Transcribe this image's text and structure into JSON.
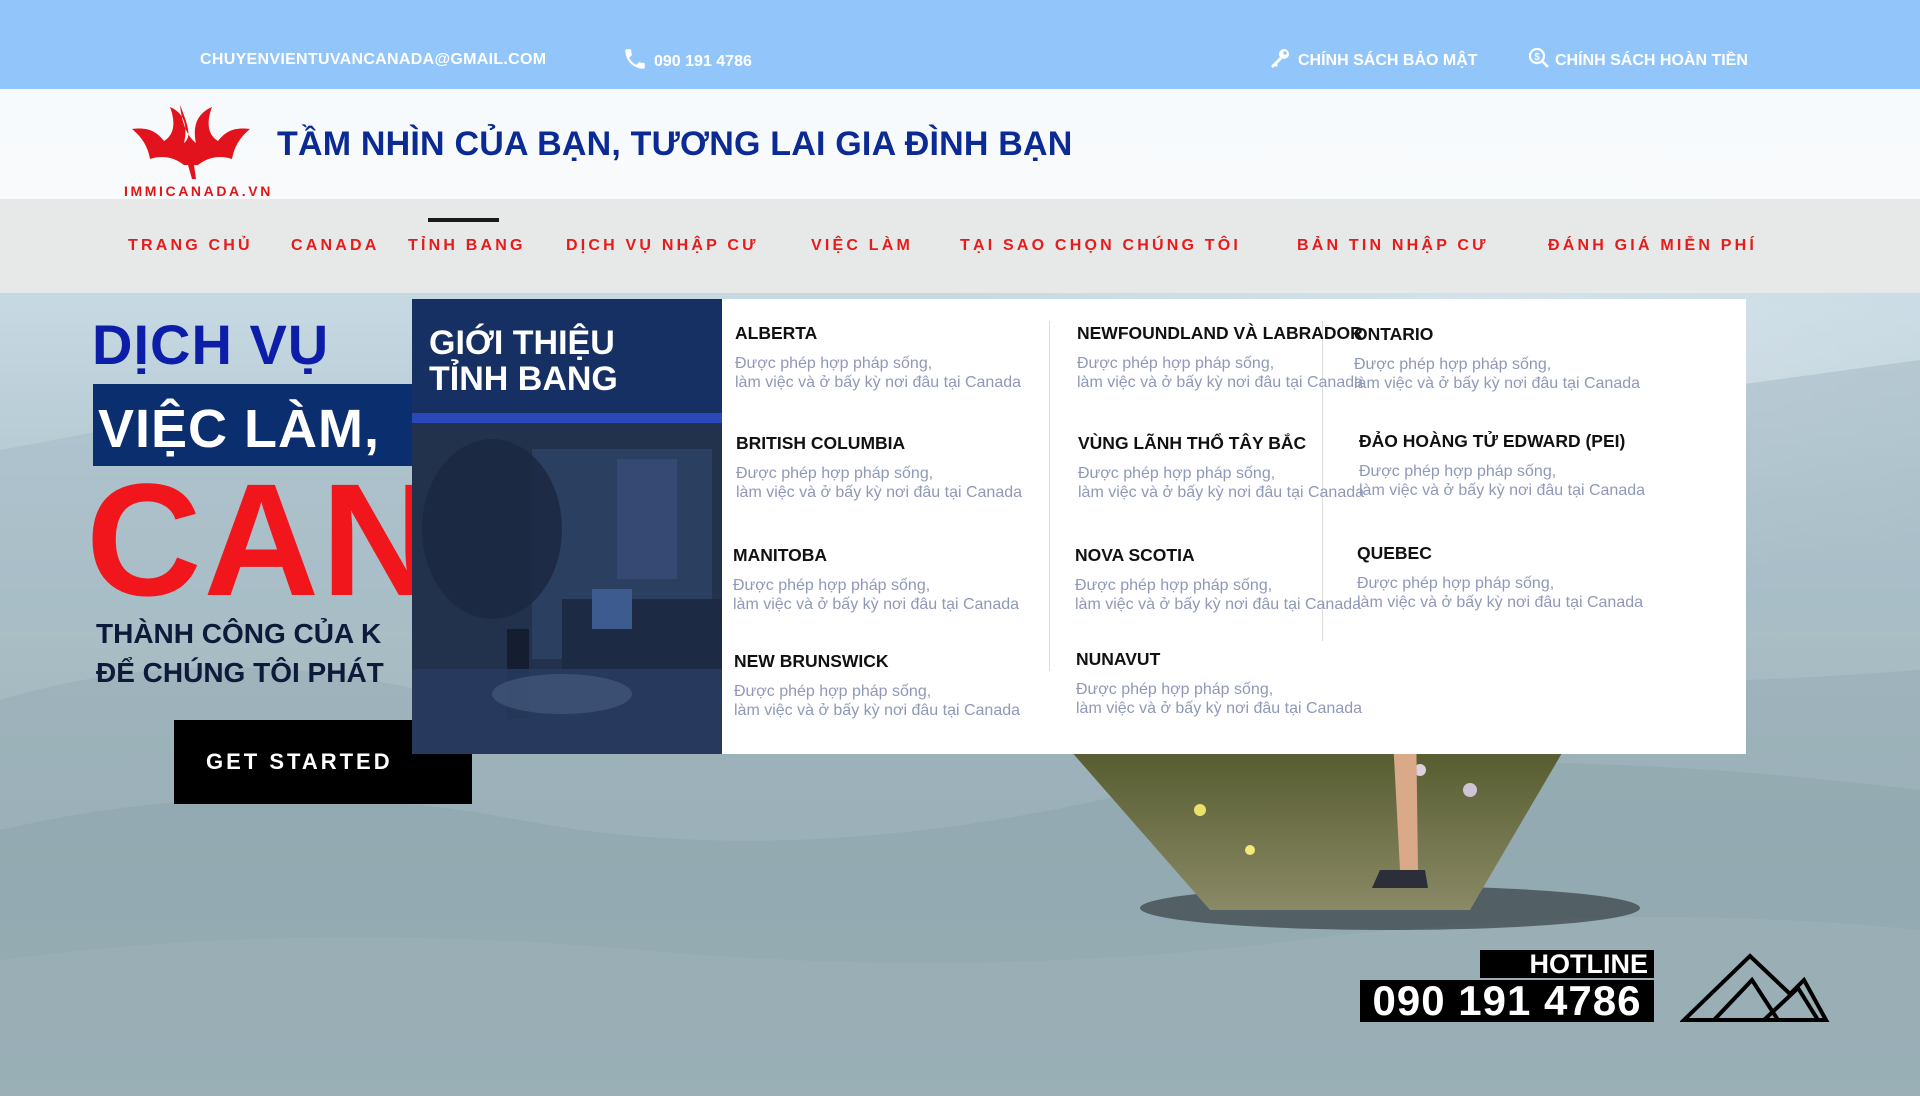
{
  "topbar": {
    "email": "CHUYENVIENTUVANCANADA@GMAIL.COM",
    "phone": "090 191 4786",
    "privacy_policy": "CHÍNH SÁCH BẢO MẬT",
    "refund_policy": "CHÍNH SÁCH HOÀN TIỀN",
    "bg_color": "#92c6fb"
  },
  "header": {
    "logo_text": "IMMICANADA.VN",
    "slogan": "TẦM NHÌN CỦA BẠN, TƯƠNG LAI GIA ĐÌNH BẠN"
  },
  "nav": {
    "items": [
      "TRANG CHỦ",
      "CANADA",
      "TỈNH BANG",
      "DỊCH VỤ NHẬP CƯ",
      "VIỆC LÀM",
      "TẠI SAO CHỌN CHÚNG TÔI",
      "BẢN TIN NHẬP CƯ",
      "ĐÁNH GIÁ MIỄN PHÍ"
    ],
    "active": "TỈNH BANG",
    "color": "#e61b1b"
  },
  "hero": {
    "line1": "DỊCH VỤ",
    "line2": "VIỆC LÀM,",
    "line3": "CAN",
    "sub1": "THÀNH CÔNG CỦA K",
    "sub2": "ĐỂ CHÚNG TÔI PHÁT",
    "cta": "GET STARTED"
  },
  "hotline": {
    "label": "HOTLINE",
    "number": "090 191 4786"
  },
  "mega_menu": {
    "title": "GIỚI THIỆU TỈNH BANG",
    "desc_line1": "Được phép hợp pháp sống,",
    "desc_line2": "làm việc và ở bấy kỳ nơi đâu tại Canada",
    "provinces": [
      {
        "name": "ALBERTA"
      },
      {
        "name": "BRITISH COLUMBIA"
      },
      {
        "name": "MANITOBA"
      },
      {
        "name": "NEW BRUNSWICK"
      },
      {
        "name": "NEWFOUNDLAND VÀ LABRADOR"
      },
      {
        "name": "VÙNG LÃNH THỔ TÂY BẮC"
      },
      {
        "name": "NOVA SCOTIA"
      },
      {
        "name": "NUNAVUT"
      },
      {
        "name": "ONTARIO"
      },
      {
        "name": "ĐẢO HOÀNG TỬ EDWARD (PEI)"
      },
      {
        "name": "QUEBEC"
      }
    ]
  }
}
